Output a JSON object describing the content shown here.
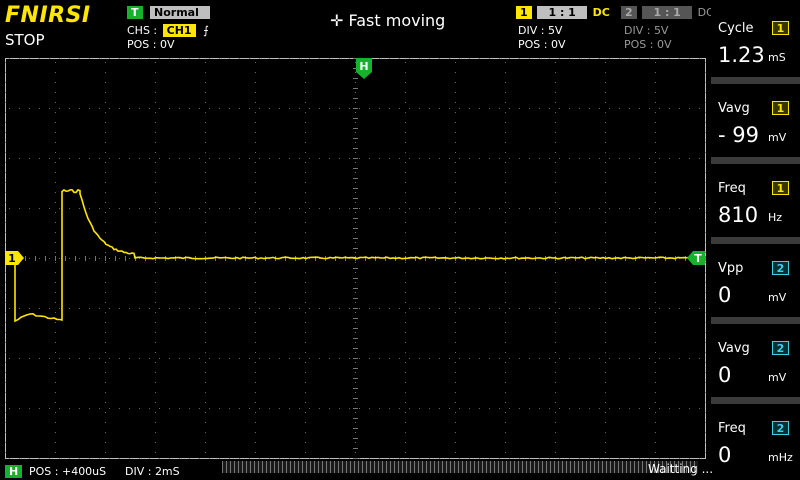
{
  "header": {
    "logo": "FNIRSI",
    "run_state": "STOP",
    "trigger": {
      "badge": "T",
      "mode": "Normal",
      "source_label": "CHS :",
      "source": "CH1",
      "edge_icon": "falling-edge-icon",
      "pos": "POS : 0V"
    },
    "interaction_mode": "Fast moving",
    "move_icon": "move-arrows-icon",
    "ch1": {
      "num": "1",
      "probe": "1 : 1",
      "coupling": "DC",
      "div": "DIV :  5V",
      "pos": "POS : 0V"
    },
    "ch2": {
      "num": "2",
      "probe": "1 : 1",
      "coupling": "DC",
      "div": "DIV :  5V",
      "pos": "POS : 0V"
    }
  },
  "plot": {
    "h_marker": "H",
    "ch1_marker": "1",
    "trigger_marker": "T",
    "trace_color": "#ffe600"
  },
  "measurements": [
    {
      "label": "Cycle",
      "channel": "1",
      "value": "1.23",
      "unit": "mS"
    },
    {
      "label": "Vavg",
      "channel": "1",
      "value": "- 99",
      "unit": "mV"
    },
    {
      "label": "Freq",
      "channel": "1",
      "value": "810",
      "unit": "Hz"
    },
    {
      "label": "Vpp",
      "channel": "2",
      "value": "0",
      "unit": "mV"
    },
    {
      "label": "Vavg",
      "channel": "2",
      "value": "0",
      "unit": "mV"
    },
    {
      "label": "Freq",
      "channel": "2",
      "value": "0",
      "unit": "mHz"
    }
  ],
  "footer": {
    "h_badge": "H",
    "pos": "POS : +400uS",
    "div": "DIV : 2mS",
    "status": "Waitting ..."
  },
  "colors": {
    "ch1": "#ffe600",
    "ch2": "#3fd0e6",
    "accent_green": "#17b12b"
  }
}
